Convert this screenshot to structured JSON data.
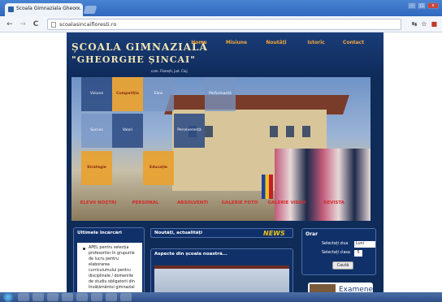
{
  "browser": {
    "tab_title": "Scoala Gimnaziala Gheor...",
    "tab_close": "×",
    "url": "scoalasincaifloresti.ro",
    "back": "←",
    "forward": "→",
    "reload": "C"
  },
  "site": {
    "title_line1": "ȘCOALA GIMNAZIALĂ",
    "title_line2": "\"GHEORGHE ȘINCAI\"",
    "subtitle": "com. Florești, jud. Cluj",
    "top_nav": [
      "Home",
      "Misiune",
      "Noutăți",
      "Istoric",
      "Contact"
    ],
    "tiles": [
      "Viziune",
      "Competiție",
      "Elevi",
      "Performanță",
      "Succes",
      "Valori",
      "Perseverență",
      "Strategie",
      "Educație"
    ],
    "menu": [
      "ELEVII NOȘTRI",
      "PERSONAL",
      "ABSOLVENȚI",
      "GALERIE FOTO",
      "GALERIE VIDEO",
      "REVISTA"
    ]
  },
  "latest": {
    "title": "Ultimele încărcări",
    "item": "APEL pentru selecția profesorilor în grupurile de lucru pentru elaborarea curriculumului pentru disciplinele / domeniile de studiu obligatorii din învățământul gimnazial"
  },
  "news": {
    "title": "Noutăți, actualități",
    "badge": "NEWS",
    "aspecte": "Aspecte din școala noastră..."
  },
  "orar": {
    "title": "Orar",
    "day_label": "Selectați ziua",
    "day_value": "Luni",
    "class_label": "Selectați clasa",
    "class_value": "5",
    "search_button": "Caută"
  },
  "examene": {
    "label": "Examene"
  }
}
